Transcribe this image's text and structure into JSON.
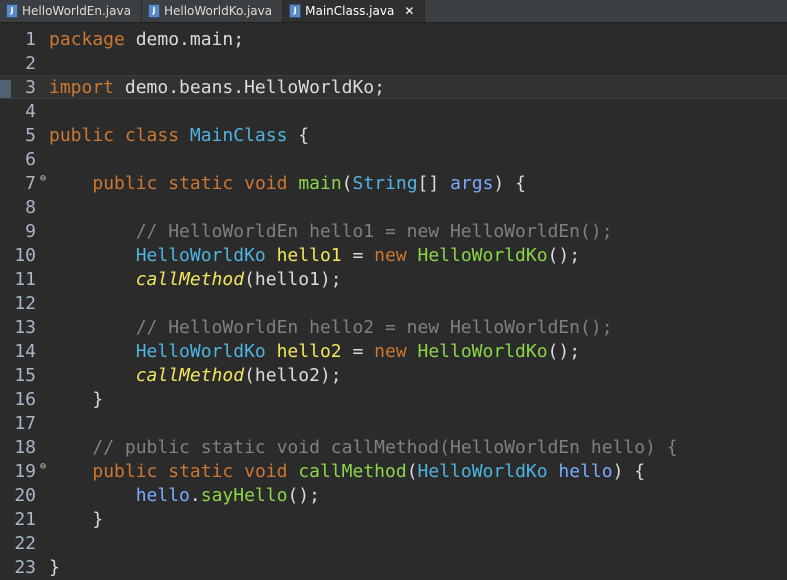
{
  "tabs": [
    {
      "label": "HelloWorldEn.java",
      "icon": "java-file-icon",
      "active": false
    },
    {
      "label": "HelloWorldKo.java",
      "icon": "java-file-icon",
      "active": false
    },
    {
      "label": "MainClass.java",
      "icon": "java-file-icon",
      "active": true,
      "close": "✕"
    }
  ],
  "lines": [
    {
      "n": "1",
      "tokens": [
        [
          "kw",
          "package"
        ],
        [
          "plain",
          " demo.main;"
        ]
      ]
    },
    {
      "n": "2",
      "tokens": []
    },
    {
      "n": "3",
      "tokens": [
        [
          "kw",
          "import"
        ],
        [
          "plain",
          " demo.beans.HelloWorldKo;"
        ]
      ],
      "current": true,
      "marker": true
    },
    {
      "n": "4",
      "tokens": []
    },
    {
      "n": "5",
      "tokens": [
        [
          "kw",
          "public"
        ],
        [
          "plain",
          " "
        ],
        [
          "kw",
          "class"
        ],
        [
          "plain",
          " "
        ],
        [
          "typ",
          "MainClass"
        ],
        [
          "plain",
          " {"
        ]
      ]
    },
    {
      "n": "6",
      "tokens": []
    },
    {
      "n": "7",
      "fold": true,
      "tokens": [
        [
          "plain",
          "    "
        ],
        [
          "kw",
          "public"
        ],
        [
          "plain",
          " "
        ],
        [
          "kw",
          "static"
        ],
        [
          "plain",
          " "
        ],
        [
          "kw",
          "void"
        ],
        [
          "plain",
          " "
        ],
        [
          "mth",
          "main"
        ],
        [
          "plain",
          "("
        ],
        [
          "typ",
          "String"
        ],
        [
          "plain",
          "[] "
        ],
        [
          "prm",
          "args"
        ],
        [
          "plain",
          ") {"
        ]
      ]
    },
    {
      "n": "8",
      "tokens": []
    },
    {
      "n": "9",
      "tokens": [
        [
          "plain",
          "        "
        ],
        [
          "cmt",
          "// HelloWorldEn hello1 = new HelloWorldEn();"
        ]
      ]
    },
    {
      "n": "10",
      "tokens": [
        [
          "plain",
          "        "
        ],
        [
          "typ",
          "HelloWorldKo"
        ],
        [
          "plain",
          " "
        ],
        [
          "var",
          "hello1"
        ],
        [
          "plain",
          " = "
        ],
        [
          "kw",
          "new"
        ],
        [
          "plain",
          " "
        ],
        [
          "mth",
          "HelloWorldKo"
        ],
        [
          "plain",
          "();"
        ]
      ]
    },
    {
      "n": "11",
      "tokens": [
        [
          "plain",
          "        "
        ],
        [
          "it",
          "callMethod"
        ],
        [
          "plain",
          "(hello1);"
        ]
      ]
    },
    {
      "n": "12",
      "tokens": []
    },
    {
      "n": "13",
      "tokens": [
        [
          "plain",
          "        "
        ],
        [
          "cmt",
          "// HelloWorldEn hello2 = new HelloWorldEn();"
        ]
      ]
    },
    {
      "n": "14",
      "tokens": [
        [
          "plain",
          "        "
        ],
        [
          "typ",
          "HelloWorldKo"
        ],
        [
          "plain",
          " "
        ],
        [
          "var",
          "hello2"
        ],
        [
          "plain",
          " = "
        ],
        [
          "kw",
          "new"
        ],
        [
          "plain",
          " "
        ],
        [
          "mth",
          "HelloWorldKo"
        ],
        [
          "plain",
          "();"
        ]
      ]
    },
    {
      "n": "15",
      "tokens": [
        [
          "plain",
          "        "
        ],
        [
          "it",
          "callMethod"
        ],
        [
          "plain",
          "(hello2);"
        ]
      ]
    },
    {
      "n": "16",
      "tokens": [
        [
          "plain",
          "    }"
        ]
      ]
    },
    {
      "n": "17",
      "tokens": []
    },
    {
      "n": "18",
      "tokens": [
        [
          "plain",
          "    "
        ],
        [
          "cmt",
          "// public static void callMethod(HelloWorldEn hello) {"
        ]
      ]
    },
    {
      "n": "19",
      "fold": true,
      "tokens": [
        [
          "plain",
          "    "
        ],
        [
          "kw",
          "public"
        ],
        [
          "plain",
          " "
        ],
        [
          "kw",
          "static"
        ],
        [
          "plain",
          " "
        ],
        [
          "kw",
          "void"
        ],
        [
          "plain",
          " "
        ],
        [
          "mth",
          "callMethod"
        ],
        [
          "plain",
          "("
        ],
        [
          "typ",
          "HelloWorldKo"
        ],
        [
          "plain",
          " "
        ],
        [
          "prm",
          "hello"
        ],
        [
          "plain",
          ") {"
        ]
      ]
    },
    {
      "n": "20",
      "tokens": [
        [
          "plain",
          "        "
        ],
        [
          "prm",
          "hello"
        ],
        [
          "plain",
          "."
        ],
        [
          "mth",
          "sayHello"
        ],
        [
          "plain",
          "();"
        ]
      ]
    },
    {
      "n": "21",
      "tokens": [
        [
          "plain",
          "    }"
        ]
      ]
    },
    {
      "n": "22",
      "tokens": []
    },
    {
      "n": "23",
      "tokens": [
        [
          "plain",
          "}"
        ]
      ]
    }
  ]
}
